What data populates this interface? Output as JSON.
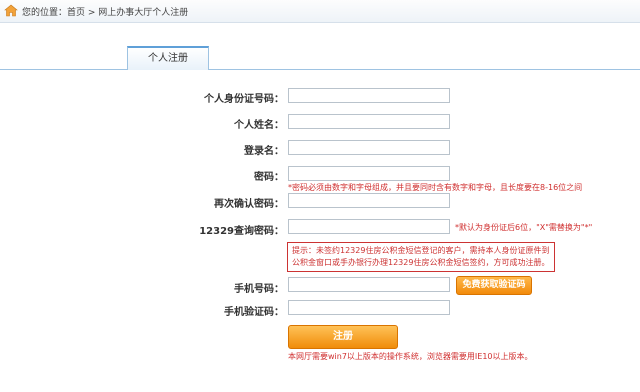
{
  "breadcrumb": {
    "text": "您的位置：首页 > 网上办事大厅个人注册"
  },
  "tab": {
    "label": "个人注册"
  },
  "form": {
    "id_label": "个人身份证号码：",
    "name_label": "个人姓名：",
    "login_label": "登录名：",
    "password_label": "密码：",
    "password_hint": "*密码必须由数字和字母组成，并且要同时含有数字和字母，且长度要在8-16位之间",
    "confirm_label": "再次确认密码：",
    "query_label": "12329查询密码：",
    "query_hint": "*默认为身份证后6位，\"X\"需替换为\"*\"",
    "notice_line1": "提示：未签约12329住房公积金短信登记的客户，需持本人身份证原件到",
    "notice_line2": "公积金窗口或手办银行办理12329住房公积金短信签约，方可成功注册。",
    "phone_label": "手机号码：",
    "sms_button": "免费获取验证码",
    "code_label": "手机验证码：",
    "register_button": "注册",
    "footer_note": "本网厅需要win7以上版本的操作系统，浏览器需要用IE10以上版本。"
  }
}
